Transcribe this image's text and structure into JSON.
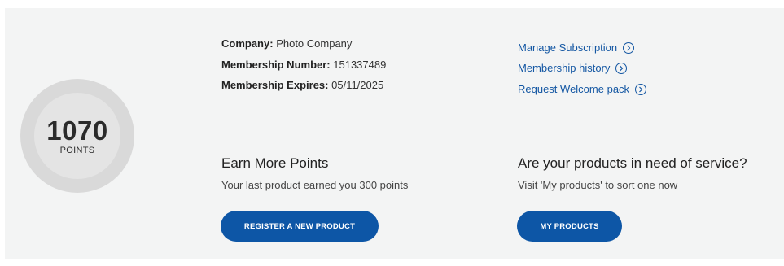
{
  "points": {
    "value": "1070",
    "label": "POINTS"
  },
  "account": {
    "company_label": "Company:",
    "company_value": "Photo Company",
    "membership_number_label": "Membership Number:",
    "membership_number_value": "151337489",
    "membership_expires_label": "Membership Expires:",
    "membership_expires_value": "05/11/2025"
  },
  "links": {
    "manage_subscription": "Manage Subscription",
    "membership_history": "Membership history",
    "request_welcome_pack": "Request Welcome pack"
  },
  "earn": {
    "title": "Earn More Points",
    "subtitle": "Your last product earned you 300 points",
    "button": "REGISTER A NEW PRODUCT"
  },
  "service": {
    "title": "Are your products in need of service?",
    "subtitle": "Visit 'My products' to sort one now",
    "button": "MY PRODUCTS"
  },
  "colors": {
    "accent": "#0d56a6",
    "link": "#1457a3",
    "panel": "#f3f4f4"
  },
  "icons": {
    "link_arrow": "chevron-right-circle-icon"
  }
}
